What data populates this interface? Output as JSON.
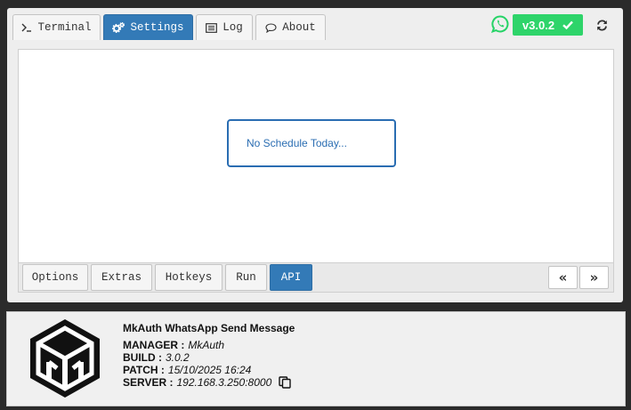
{
  "tabs": [
    {
      "label": "Terminal",
      "icon": "terminal-icon"
    },
    {
      "label": "Settings",
      "icon": "cogs-icon",
      "active": true
    },
    {
      "label": "Log",
      "icon": "list-icon"
    },
    {
      "label": "About",
      "icon": "comment-icon"
    }
  ],
  "header": {
    "version": "v3.0.2",
    "whatsapp_icon": "whatsapp-icon",
    "refresh_icon": "refresh-icon",
    "badge_color": "#2ed46a",
    "accent_color": "#337ab7"
  },
  "content": {
    "message": "No Schedule Today..."
  },
  "bottom_tabs": [
    {
      "label": "Options"
    },
    {
      "label": "Extras"
    },
    {
      "label": "Hotkeys"
    },
    {
      "label": "Run"
    },
    {
      "label": "API",
      "active": true
    }
  ],
  "nav": {
    "prev": "«",
    "next": "»"
  },
  "footer": {
    "app_name": "MkAuth WhatsApp Send Message",
    "manager_label": "MANAGER :",
    "manager_value": "MkAuth",
    "build_label": "BUILD :",
    "build_value": "3.0.2",
    "patch_label": "PATCH :",
    "patch_value": "15/10/2025 16:24",
    "server_label": "SERVER :",
    "server_value": "192.168.3.250:8000",
    "copy_icon": "copy-icon",
    "logo_icon": "mkauth-logo-icon"
  }
}
